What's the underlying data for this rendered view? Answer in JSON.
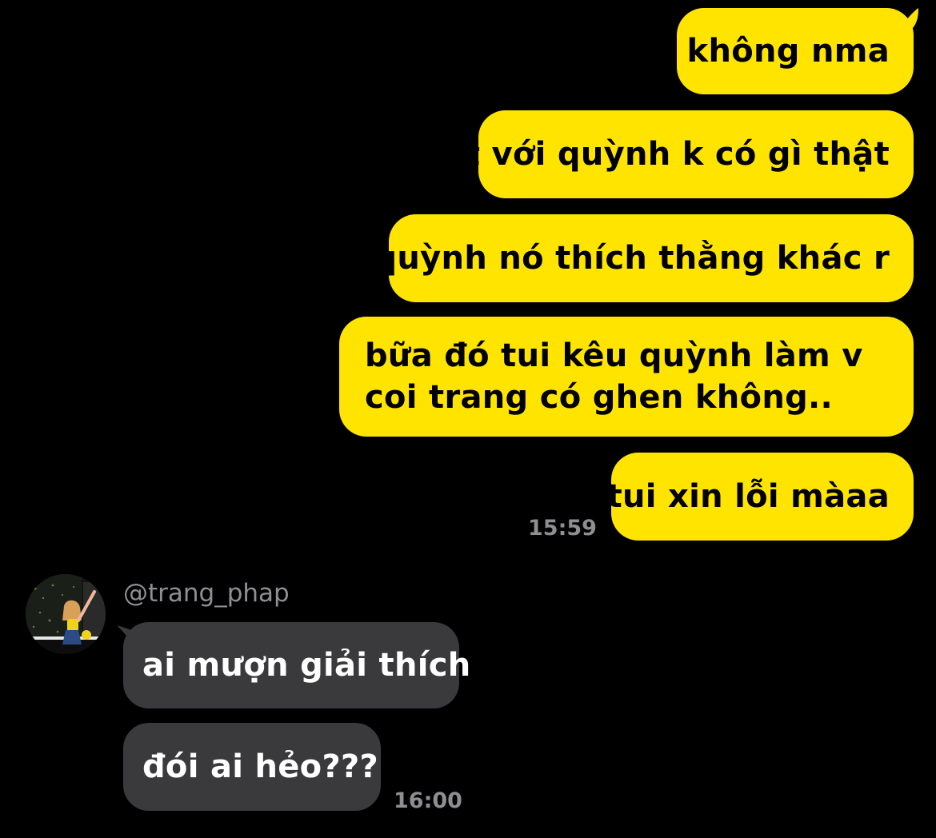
{
  "outgoing": [
    {
      "text": "không nma"
    },
    {
      "text": "t với quỳnh k có gì thật"
    },
    {
      "text": "quỳnh nó thích thằng khác r"
    },
    {
      "text": "bữa đó tui kêu quỳnh làm v coi trang có ghen không.."
    },
    {
      "text": "tui xin lỗi màaa"
    }
  ],
  "outgoing_time": "15:59",
  "incoming": {
    "username": "@trang_phap",
    "messages": [
      {
        "text": "ai mượn giải thích"
      },
      {
        "text": "đói ai hẻo???"
      }
    ],
    "time": "16:00"
  },
  "colors": {
    "background": "#000000",
    "sent_bubble": "#FFE400",
    "received_bubble": "#3A3A3C",
    "timestamp": "#8E8E93"
  },
  "icons": {
    "avatar": "user-avatar-photo"
  }
}
